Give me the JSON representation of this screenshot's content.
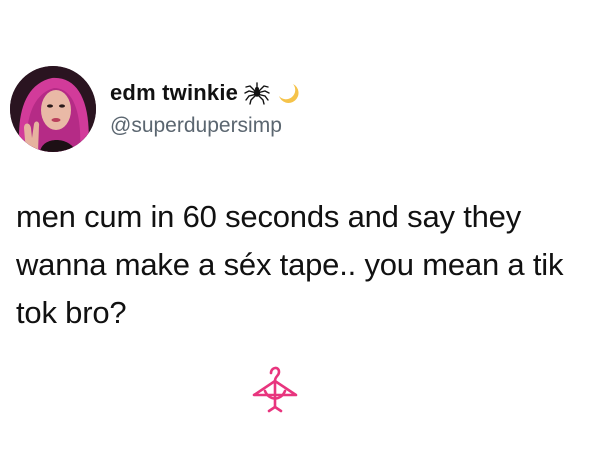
{
  "profile": {
    "display_name": "edm twinkie",
    "handle": "@superdupersimp",
    "avatar_icon": "profile-photo",
    "name_emojis": [
      "spider-icon",
      "crescent-moon-icon"
    ]
  },
  "tweet": {
    "text": "men cum in 60 seconds and say they wanna make a séx tape.. you mean a tik tok bro?"
  },
  "watermark": {
    "icon": "hanger-watermark-icon",
    "color": "#e8357e"
  },
  "colors": {
    "handle": "#5b6670",
    "moon": "#f5c34a"
  }
}
